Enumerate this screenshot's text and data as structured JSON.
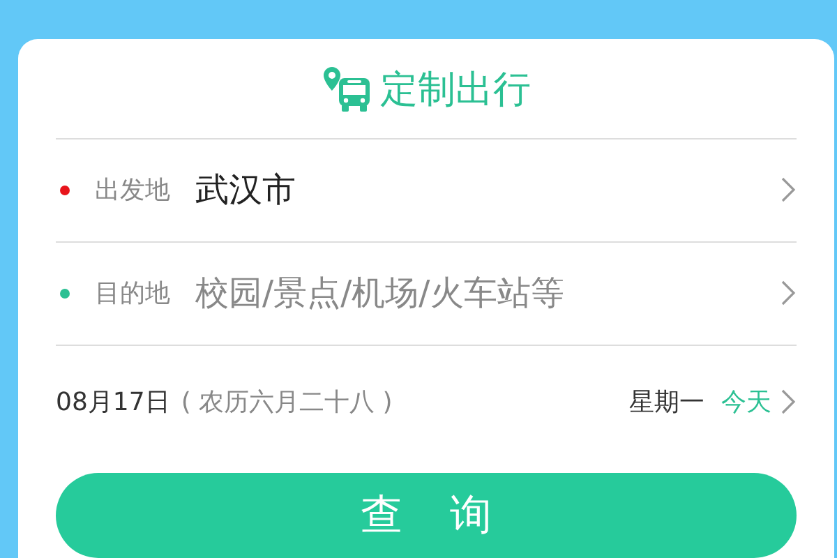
{
  "header": {
    "title": "定制出行"
  },
  "locations": [
    {
      "label": "出发地",
      "value": "武汉市",
      "color": "#e8141b"
    },
    {
      "label": "目的地",
      "placeholder": "校园/景点/机场/火车站等",
      "color": "#2bc093"
    }
  ],
  "date": {
    "date": "08月17日",
    "lunar": "( 农历六月二十八 )",
    "weekday": "星期一",
    "relative": "今天"
  },
  "search_button": "查 询"
}
